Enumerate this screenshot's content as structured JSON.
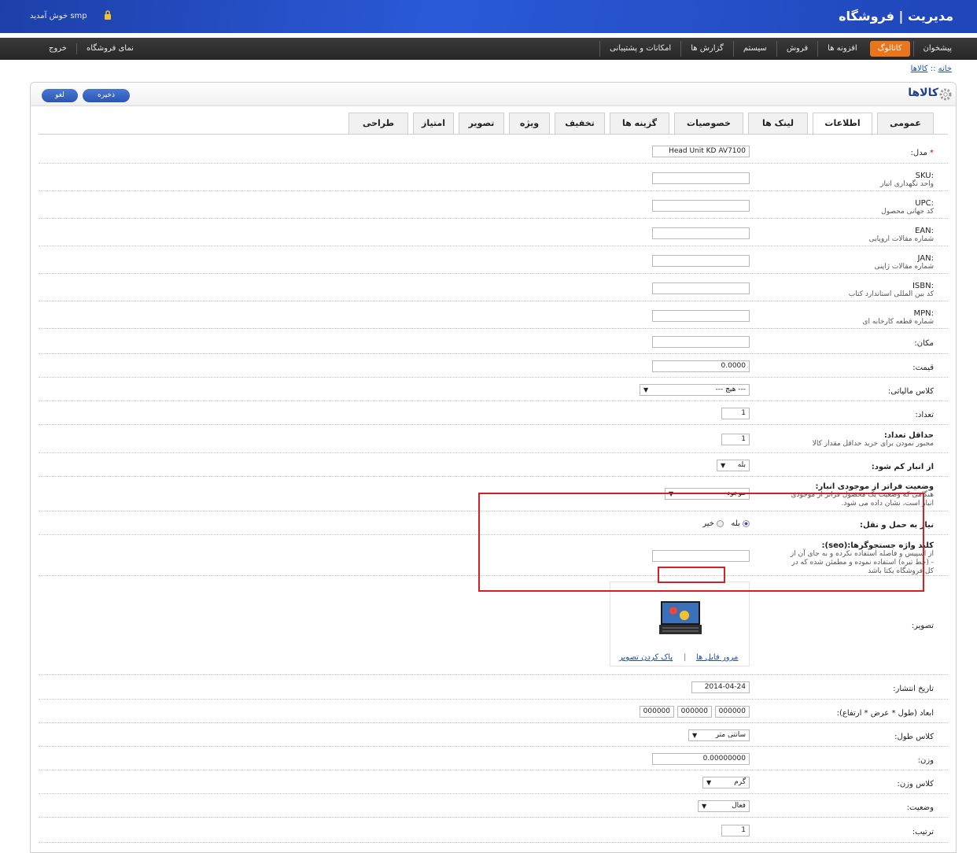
{
  "header": {
    "title": "مدیریت | فروشگاه",
    "welcome": "smp خوش آمدید"
  },
  "menu": {
    "items": [
      "پیشخوان",
      "کاتالوگ",
      "افزونه ها",
      "فروش",
      "سیستم",
      "گزارش ها",
      "امکانات و پشتیبانی"
    ],
    "active_index": 1,
    "store_front": "نمای فروشگاه",
    "logout": "خروج"
  },
  "breadcrumb": {
    "home": "خانه",
    "sep": " :: ",
    "current": "کالاها"
  },
  "page": {
    "title": "کالاها",
    "save": "ذخیره",
    "cancel": "لغو"
  },
  "tabs": [
    "عمومی",
    "اطلاعات",
    "لینک ها",
    "خصوصیات",
    "گزینه ها",
    "تخفیف",
    "ویژه",
    "تصویر",
    "امتیاز",
    "طراحی"
  ],
  "active_tab": 1,
  "form": {
    "model": {
      "label": "مدل:",
      "value": "Head Unit KD AV7100"
    },
    "sku": {
      "label": ":SKU",
      "help": "واحد نگهداری انبار",
      "value": ""
    },
    "upc": {
      "label": ":UPC",
      "help": "کد جهانی محصول",
      "value": ""
    },
    "ean": {
      "label": ":EAN",
      "help": "شماره مقالات اروپایی",
      "value": ""
    },
    "jan": {
      "label": ":JAN",
      "help": "شماره مقالات ژاپنی",
      "value": ""
    },
    "isbn": {
      "label": ":ISBN",
      "help": "کد بین المللی استاندارد کتاب",
      "value": ""
    },
    "mpn": {
      "label": ":MPN",
      "help": "شماره قطعه کارخانه ای",
      "value": ""
    },
    "location": {
      "label": "مکان:",
      "value": ""
    },
    "price": {
      "label": "قیمت:",
      "value": "0.0000"
    },
    "tax_class": {
      "label": "کلاس مالیاتی:",
      "value": "--- هیچ ---"
    },
    "quantity": {
      "label": "تعداد:",
      "value": "1"
    },
    "minimum": {
      "label": "حداقل تعداد:",
      "help": "مجبور نمودن برای خرید حداقل مقدار کالا",
      "value": "1"
    },
    "subtract": {
      "label": "از انبار کم شود:",
      "value": "بله"
    },
    "stock_status": {
      "label": "وضعیت فراتر از موجودی انبار:",
      "help1": "هنگامی که وضعیت یک محصول فراتر از موجودی",
      "help2": "انبار است، نشان داده می شود.",
      "value": "موجود"
    },
    "shipping": {
      "label": "نیاز به حمل و نقل:",
      "yes": "بله",
      "no": "خیر",
      "selected": "yes"
    },
    "seo": {
      "label": "کلید واژه جستجوگرها:(seo):",
      "help1": "از اسپیس و فاصله استفاده نکرده و به جای آن از",
      "help2": "- (خط تیره) استفاده نموده و مطمئن شده که در",
      "help3": "کل فروشگاه یکتا باشد",
      "value": ""
    },
    "image": {
      "label": "تصویر:",
      "browse": "مرور فایل ها",
      "clear": "پاک کردن تصویر",
      "sep": "|"
    },
    "date": {
      "label": "تاریخ انتشار:",
      "value": "2014-04-24"
    },
    "dimensions": {
      "label": "ابعاد (طول * عرض * ارتفاع):",
      "length": "000000",
      "width": "000000",
      "height": "000000"
    },
    "length_class": {
      "label": "کلاس طول:",
      "value": "سانتی متر"
    },
    "weight": {
      "label": "وزن:",
      "value": "0.00000000"
    },
    "weight_class": {
      "label": "کلاس وزن:",
      "value": "گرم"
    },
    "status": {
      "label": "وضعیت:",
      "value": "فعال"
    },
    "sort": {
      "label": "ترتیب:",
      "value": "1"
    }
  }
}
